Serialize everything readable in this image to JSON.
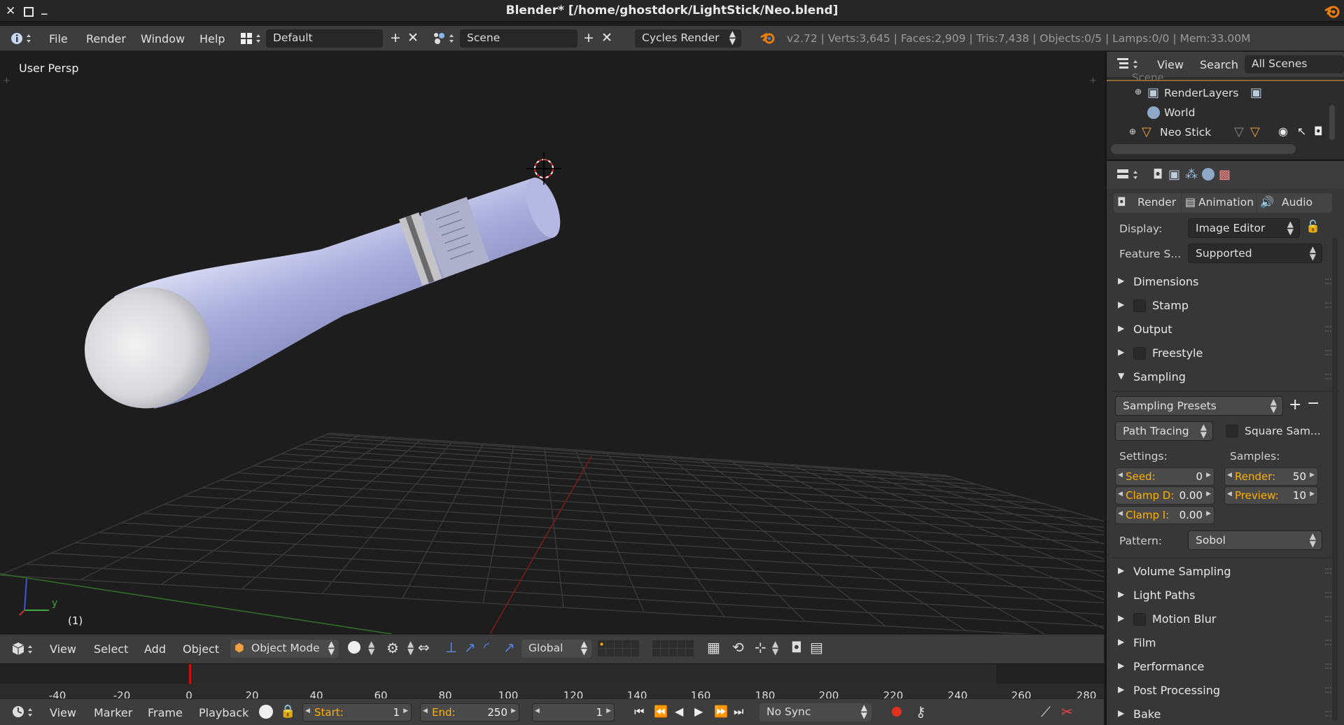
{
  "window": {
    "title": "Blender* [/home/ghostdork/LightStick/Neo.blend]"
  },
  "infobar": {
    "menus": [
      "File",
      "Render",
      "Window",
      "Help"
    ],
    "screen_layout": "Default",
    "scene": "Scene",
    "render_engine": "Cycles Render",
    "stats": "v2.72 | Verts:3,645 | Faces:2,909 | Tris:7,438 | Objects:0/5 | Lamps:0/0 | Mem:33.00M"
  },
  "viewport": {
    "label": "User Persp",
    "frame_indicator": "(1)",
    "axis_y": "y"
  },
  "view3d_header": {
    "menus": [
      "View",
      "Select",
      "Add",
      "Object"
    ],
    "mode": "Object Mode",
    "orientation": "Global"
  },
  "timeline": {
    "ticks": [
      "-40",
      "-20",
      "0",
      "20",
      "40",
      "60",
      "80",
      "100",
      "120",
      "140",
      "160",
      "180",
      "200",
      "220",
      "240",
      "260",
      "280"
    ],
    "current_frame": 1
  },
  "timeline_footer": {
    "menus": [
      "View",
      "Marker",
      "Frame",
      "Playback"
    ],
    "start_label": "Start:",
    "start_value": "1",
    "end_label": "End:",
    "end_value": "250",
    "current": "1",
    "sync": "No Sync"
  },
  "outliner": {
    "menus": [
      "View",
      "Search"
    ],
    "filter": "All Scenes",
    "items": [
      "Scene",
      "RenderLayers",
      "World",
      "Neo Stick"
    ]
  },
  "properties": {
    "tabs": [
      "Render",
      "Animation",
      "Audio"
    ],
    "display_label": "Display:",
    "display_value": "Image Editor",
    "feature_label": "Feature S...",
    "feature_value": "Supported",
    "panels_top": [
      {
        "label": "Dimensions",
        "check": false
      },
      {
        "label": "Stamp",
        "check": true
      },
      {
        "label": "Output",
        "check": false
      },
      {
        "label": "Freestyle",
        "check": true
      },
      {
        "label": "Sampling",
        "check": false
      }
    ],
    "sampling": {
      "presets": "Sampling Presets",
      "method": "Path Tracing",
      "square_samples": "Square Sam...",
      "settings_label": "Settings:",
      "samples_label": "Samples:",
      "seed_label": "Seed:",
      "seed_value": "0",
      "clamp_d_label": "Clamp D:",
      "clamp_d_value": "0.00",
      "clamp_i_label": "Clamp I:",
      "clamp_i_value": "0.00",
      "render_label": "Render:",
      "render_value": "50",
      "preview_label": "Preview:",
      "preview_value": "10",
      "pattern_label": "Pattern:",
      "pattern_value": "Sobol"
    },
    "panels_bottom": [
      {
        "label": "Volume Sampling",
        "check": false
      },
      {
        "label": "Light Paths",
        "check": false
      },
      {
        "label": "Motion Blur",
        "check": true
      },
      {
        "label": "Film",
        "check": false
      },
      {
        "label": "Performance",
        "check": false
      },
      {
        "label": "Post Processing",
        "check": false
      },
      {
        "label": "Bake",
        "check": false
      }
    ]
  },
  "colors": {
    "accent": "#ffb000",
    "grid_x_axis": "#8b1e1e",
    "grid_y_axis": "#3a7d2a",
    "stick": "#a9addc",
    "frame_marker": "#d01010"
  }
}
